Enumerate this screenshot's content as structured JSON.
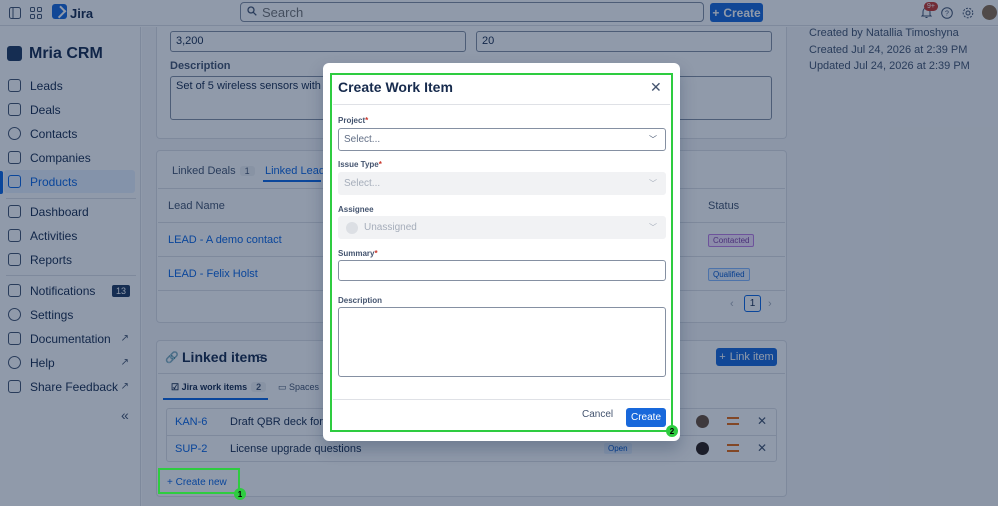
{
  "topbar": {
    "app_name": "Jira",
    "search_placeholder": "Search",
    "create_label": "Create",
    "notification_badge": "9+"
  },
  "sidebar": {
    "brand": "Mria CRM",
    "items": [
      {
        "label": "Leads",
        "icon": "leads-icon"
      },
      {
        "label": "Deals",
        "icon": "deals-icon"
      },
      {
        "label": "Contacts",
        "icon": "contacts-icon"
      },
      {
        "label": "Companies",
        "icon": "companies-icon"
      },
      {
        "label": "Products",
        "icon": "products-icon",
        "active": true
      },
      {
        "label": "Dashboard",
        "icon": "dashboard-icon"
      },
      {
        "label": "Activities",
        "icon": "activities-icon"
      },
      {
        "label": "Reports",
        "icon": "reports-icon"
      },
      {
        "label": "Notifications",
        "icon": "bell-icon",
        "badge": "13"
      },
      {
        "label": "Settings",
        "icon": "gear-icon"
      },
      {
        "label": "Documentation",
        "icon": "doc-icon"
      },
      {
        "label": "Help",
        "icon": "help-icon"
      },
      {
        "label": "Share Feedback",
        "icon": "feedback-icon"
      }
    ]
  },
  "product": {
    "price_value": "3,200",
    "quantity_value": "20",
    "description_label": "Description",
    "description_value": "Set of 5 wireless sensors with mounting",
    "meta": {
      "created_by": "Created by Natallia Timoshyna",
      "created_at": "Created Jul 24, 2026 at 2:39 PM",
      "updated_at": "Updated Jul 24, 2026 at 2:39 PM"
    }
  },
  "linked_tabs": {
    "deals_label": "Linked Deals",
    "deals_count": "1",
    "leads_label": "Linked Leads"
  },
  "leads_table": {
    "col_lead_name": "Lead Name",
    "col_status": "Status",
    "rows": [
      {
        "name": "LEAD - A demo contact",
        "status": "Contacted"
      },
      {
        "name": "LEAD - Felix Holst",
        "status": "Qualified"
      }
    ],
    "page": "1"
  },
  "linked_items": {
    "title": "Linked items",
    "count": "3",
    "link_button": "Link item",
    "tab_jira": "Jira work items",
    "tab_jira_count": "2",
    "tab_spaces": "Spaces",
    "rows": [
      {
        "key": "KAN-6",
        "summary": "Draft QBR deck for Q4 r",
        "status": ""
      },
      {
        "key": "SUP-2",
        "summary": "License upgrade questions",
        "status": "Open"
      }
    ],
    "create_new": "Create new"
  },
  "modal": {
    "title": "Create Work Item",
    "project_label": "Project",
    "project_placeholder": "Select...",
    "issue_type_label": "Issue Type",
    "issue_type_placeholder": "Select...",
    "assignee_label": "Assignee",
    "assignee_placeholder": "Unassigned",
    "summary_label": "Summary",
    "description_label": "Description",
    "required_mark": "*",
    "cancel_label": "Cancel",
    "create_label": "Create"
  },
  "annotations": [
    {
      "number": "1",
      "target": "create-new-link"
    },
    {
      "number": "2",
      "target": "create-work-item-modal"
    }
  ],
  "colors": {
    "accent": "#1868db",
    "annotation": "#2ecc40",
    "overlay": "rgba(9,30,66,0.45)"
  }
}
